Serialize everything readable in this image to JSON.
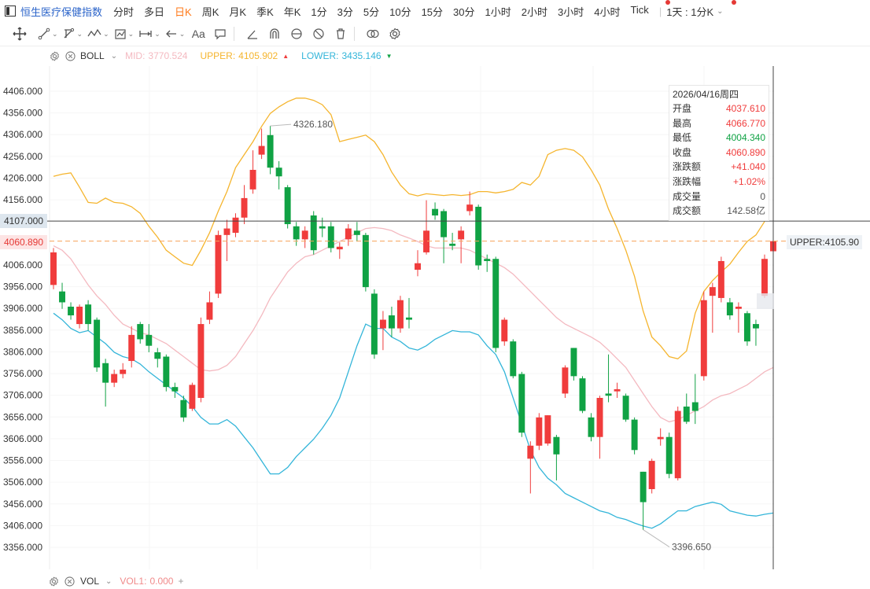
{
  "header": {
    "title": "恒生医疗保健指数",
    "timeframes": [
      "分时",
      "多日",
      "日K",
      "周K",
      "月K",
      "季K",
      "年K",
      "1分",
      "3分",
      "5分",
      "10分",
      "15分",
      "30分",
      "1小时",
      "2小时",
      "3小时",
      "4小时",
      "Tick"
    ],
    "active_timeframe": "日K",
    "period_select": "1天 : 1分K"
  },
  "toolbar": {
    "text_tool_label": "Aa"
  },
  "indicator": {
    "name": "BOLL",
    "mid_label": "MID:",
    "mid_value": "3770.524",
    "upper_label": "UPPER:",
    "upper_value": "4105.902",
    "lower_label": "LOWER:",
    "lower_value": "3435.146"
  },
  "volume": {
    "name": "VOL",
    "vol1_label": "VOL1:",
    "vol1_value": "0.000"
  },
  "colors": {
    "up": "#f03c3c",
    "down": "#10a244",
    "mid": "#f4b9c0",
    "upper": "#f5b52e",
    "lower": "#33b5d9",
    "accent": "#2a63c9"
  },
  "info": {
    "date": "2026/04/16周四",
    "rows": [
      {
        "k": "开盘",
        "v": "4037.610",
        "c": "up"
      },
      {
        "k": "最高",
        "v": "4066.770",
        "c": "up"
      },
      {
        "k": "最低",
        "v": "4004.340",
        "c": "down"
      },
      {
        "k": "收盘",
        "v": "4060.890",
        "c": "up"
      },
      {
        "k": "涨跌额",
        "v": "+41.040",
        "c": "up"
      },
      {
        "k": "涨跌幅",
        "v": "+1.02%",
        "c": "up"
      },
      {
        "k": "成交量",
        "v": "0",
        "c": "neutral"
      },
      {
        "k": "成交额",
        "v": "142.58亿",
        "c": "neutral"
      }
    ]
  },
  "tags": {
    "cross_price": "4107.000",
    "last_price": "4060.890",
    "upper_tag": "UPPER:4105.90"
  },
  "chart_data": {
    "type": "candlestick",
    "y_ticks": [
      "4406.000",
      "4356.000",
      "4306.000",
      "4256.000",
      "4206.000",
      "4156.000",
      "4107.000",
      "4060.890",
      "4006.000",
      "3956.000",
      "3906.000",
      "3856.000",
      "3806.000",
      "3756.000",
      "3706.000",
      "3656.000",
      "3606.000",
      "3556.000",
      "3506.000",
      "3456.000",
      "3406.000",
      "3356.000"
    ],
    "y_range": [
      3330,
      4440
    ],
    "max_label": "4326.180",
    "min_label": "3396.650",
    "candles": [
      {
        "o": 3960,
        "c": 4035,
        "h": 4045,
        "l": 3950
      },
      {
        "o": 3945,
        "c": 3920,
        "h": 3965,
        "l": 3905
      },
      {
        "o": 3910,
        "c": 3890,
        "h": 3920,
        "l": 3880
      },
      {
        "o": 3870,
        "c": 3910,
        "h": 3915,
        "l": 3860
      },
      {
        "o": 3915,
        "c": 3870,
        "h": 3925,
        "l": 3855
      },
      {
        "o": 3880,
        "c": 3770,
        "h": 3885,
        "l": 3760
      },
      {
        "o": 3780,
        "c": 3735,
        "h": 3790,
        "l": 3680
      },
      {
        "o": 3735,
        "c": 3755,
        "h": 3765,
        "l": 3725
      },
      {
        "o": 3755,
        "c": 3765,
        "h": 3780,
        "l": 3745
      },
      {
        "o": 3785,
        "c": 3845,
        "h": 3865,
        "l": 3770
      },
      {
        "o": 3870,
        "c": 3835,
        "h": 3875,
        "l": 3825
      },
      {
        "o": 3845,
        "c": 3820,
        "h": 3870,
        "l": 3805
      },
      {
        "o": 3805,
        "c": 3790,
        "h": 3815,
        "l": 3770
      },
      {
        "o": 3795,
        "c": 3725,
        "h": 3800,
        "l": 3715
      },
      {
        "o": 3725,
        "c": 3715,
        "h": 3735,
        "l": 3700
      },
      {
        "o": 3695,
        "c": 3655,
        "h": 3705,
        "l": 3645
      },
      {
        "o": 3675,
        "c": 3730,
        "h": 3735,
        "l": 3670
      },
      {
        "o": 3700,
        "c": 3870,
        "h": 3885,
        "l": 3690
      },
      {
        "o": 3880,
        "c": 3920,
        "h": 3945,
        "l": 3870
      },
      {
        "o": 3940,
        "c": 4075,
        "h": 4085,
        "l": 3930
      },
      {
        "o": 4075,
        "c": 4090,
        "h": 4110,
        "l": 4015
      },
      {
        "o": 4080,
        "c": 4115,
        "h": 4125,
        "l": 4070
      },
      {
        "o": 4115,
        "c": 4160,
        "h": 4190,
        "l": 4100
      },
      {
        "o": 4180,
        "c": 4225,
        "h": 4270,
        "l": 4170
      },
      {
        "o": 4260,
        "c": 4280,
        "h": 4320,
        "l": 4250
      },
      {
        "o": 4305,
        "c": 4230,
        "h": 4326,
        "l": 4215
      },
      {
        "o": 4230,
        "c": 4210,
        "h": 4245,
        "l": 4180
      },
      {
        "o": 4185,
        "c": 4100,
        "h": 4190,
        "l": 4090
      },
      {
        "o": 4095,
        "c": 4065,
        "h": 4105,
        "l": 4050
      },
      {
        "o": 4065,
        "c": 4085,
        "h": 4095,
        "l": 4045
      },
      {
        "o": 4120,
        "c": 4040,
        "h": 4130,
        "l": 4030
      },
      {
        "o": 4095,
        "c": 4090,
        "h": 4115,
        "l": 4070
      },
      {
        "o": 4095,
        "c": 4045,
        "h": 4105,
        "l": 4035
      },
      {
        "o": 4042,
        "c": 4048,
        "h": 4058,
        "l": 4020
      },
      {
        "o": 4065,
        "c": 4090,
        "h": 4100,
        "l": 4050
      },
      {
        "o": 4085,
        "c": 4075,
        "h": 4105,
        "l": 4060
      },
      {
        "o": 4075,
        "c": 3955,
        "h": 4080,
        "l": 3945
      },
      {
        "o": 3940,
        "c": 3800,
        "h": 3950,
        "l": 3790
      },
      {
        "o": 3860,
        "c": 3880,
        "h": 3900,
        "l": 3810
      },
      {
        "o": 3890,
        "c": 3860,
        "h": 3910,
        "l": 3840
      },
      {
        "o": 3860,
        "c": 3925,
        "h": 3935,
        "l": 3850
      },
      {
        "o": 3885,
        "c": 3880,
        "h": 3930,
        "l": 3860
      },
      {
        "o": 3995,
        "c": 4010,
        "h": 4040,
        "l": 3980
      },
      {
        "o": 4035,
        "c": 4085,
        "h": 4155,
        "l": 4030
      },
      {
        "o": 4135,
        "c": 4120,
        "h": 4150,
        "l": 4110
      },
      {
        "o": 4130,
        "c": 4070,
        "h": 4135,
        "l": 4010
      },
      {
        "o": 4055,
        "c": 4050,
        "h": 4080,
        "l": 4040
      },
      {
        "o": 4065,
        "c": 4085,
        "h": 4095,
        "l": 4010
      },
      {
        "o": 4130,
        "c": 4145,
        "h": 4175,
        "l": 4120
      },
      {
        "o": 4140,
        "c": 4005,
        "h": 4145,
        "l": 3995
      },
      {
        "o": 4020,
        "c": 4015,
        "h": 4030,
        "l": 3990
      },
      {
        "o": 4020,
        "c": 3815,
        "h": 4025,
        "l": 3805
      },
      {
        "o": 3830,
        "c": 3880,
        "h": 3885,
        "l": 3820
      },
      {
        "o": 3830,
        "c": 3750,
        "h": 3835,
        "l": 3745
      },
      {
        "o": 3755,
        "c": 3620,
        "h": 3760,
        "l": 3610
      },
      {
        "o": 3560,
        "c": 3590,
        "h": 3600,
        "l": 3480
      },
      {
        "o": 3590,
        "c": 3655,
        "h": 3665,
        "l": 3580
      },
      {
        "o": 3595,
        "c": 3660,
        "h": 3660,
        "l": 3590
      },
      {
        "o": 3610,
        "c": 3570,
        "h": 3615,
        "l": 3510
      },
      {
        "o": 3710,
        "c": 3770,
        "h": 3775,
        "l": 3700
      },
      {
        "o": 3815,
        "c": 3750,
        "h": 3815,
        "l": 3740
      },
      {
        "o": 3745,
        "c": 3670,
        "h": 3750,
        "l": 3665
      },
      {
        "o": 3655,
        "c": 3610,
        "h": 3665,
        "l": 3600
      },
      {
        "o": 3610,
        "c": 3700,
        "h": 3705,
        "l": 3560
      },
      {
        "o": 3710,
        "c": 3705,
        "h": 3800,
        "l": 3690
      },
      {
        "o": 3715,
        "c": 3720,
        "h": 3735,
        "l": 3700
      },
      {
        "o": 3705,
        "c": 3650,
        "h": 3710,
        "l": 3645
      },
      {
        "o": 3650,
        "c": 3580,
        "h": 3655,
        "l": 3570
      },
      {
        "o": 3530,
        "c": 3460,
        "h": 3530,
        "l": 3396
      },
      {
        "o": 3490,
        "c": 3555,
        "h": 3560,
        "l": 3480
      },
      {
        "o": 3605,
        "c": 3610,
        "h": 3630,
        "l": 3590
      },
      {
        "o": 3610,
        "c": 3525,
        "h": 3620,
        "l": 3515
      },
      {
        "o": 3515,
        "c": 3670,
        "h": 3680,
        "l": 3510
      },
      {
        "o": 3680,
        "c": 3645,
        "h": 3710,
        "l": 3640
      },
      {
        "o": 3690,
        "c": 3670,
        "h": 3755,
        "l": 3640
      },
      {
        "o": 3750,
        "c": 3925,
        "h": 3945,
        "l": 3740
      },
      {
        "o": 3935,
        "c": 3955,
        "h": 3965,
        "l": 3850
      },
      {
        "o": 3930,
        "c": 4015,
        "h": 4025,
        "l": 3920
      },
      {
        "o": 3920,
        "c": 3890,
        "h": 3930,
        "l": 3880
      },
      {
        "o": 3905,
        "c": 3910,
        "h": 3920,
        "l": 3850
      },
      {
        "o": 3895,
        "c": 3830,
        "h": 3900,
        "l": 3820
      },
      {
        "o": 3870,
        "c": 3860,
        "h": 3880,
        "l": 3820
      },
      {
        "o": 3935,
        "c": 4020,
        "h": 4030,
        "l": 3930
      },
      {
        "o": 4037.61,
        "c": 4060.89,
        "h": 4066.77,
        "l": 4004.34
      }
    ],
    "boll_mid": [
      4050,
      4040,
      4020,
      3990,
      3960,
      3935,
      3915,
      3890,
      3870,
      3860,
      3850,
      3845,
      3835,
      3825,
      3810,
      3795,
      3780,
      3765,
      3762,
      3765,
      3775,
      3795,
      3825,
      3855,
      3890,
      3930,
      3960,
      3990,
      4010,
      4025,
      4030,
      4040,
      4050,
      4060,
      4070,
      4080,
      4090,
      4092,
      4090,
      4085,
      4075,
      4068,
      4060,
      4050,
      4045,
      4045,
      4045,
      4045,
      4040,
      4030,
      4020,
      4010,
      4000,
      3985,
      3965,
      3945,
      3925,
      3905,
      3885,
      3870,
      3860,
      3850,
      3840,
      3828,
      3810,
      3790,
      3770,
      3740,
      3710,
      3680,
      3655,
      3645,
      3650,
      3660,
      3670,
      3680,
      3695,
      3705,
      3710,
      3720,
      3730,
      3745,
      3760,
      3770
    ],
    "boll_upper": [
      4210,
      4215,
      4218,
      4185,
      4150,
      4148,
      4160,
      4150,
      4148,
      4140,
      4125,
      4095,
      4070,
      4040,
      4025,
      4010,
      4005,
      4040,
      4080,
      4130,
      4175,
      4230,
      4260,
      4290,
      4325,
      4355,
      4370,
      4382,
      4390,
      4390,
      4385,
      4375,
      4352,
      4290,
      4295,
      4300,
      4305,
      4290,
      4260,
      4220,
      4190,
      4170,
      4165,
      4170,
      4168,
      4166,
      4168,
      4166,
      4168,
      4175,
      4175,
      4172,
      4175,
      4180,
      4196,
      4190,
      4210,
      4260,
      4270,
      4274,
      4270,
      4255,
      4225,
      4190,
      4135,
      4090,
      4040,
      3980,
      3900,
      3840,
      3820,
      3795,
      3790,
      3808,
      3895,
      3945,
      3970,
      3990,
      4008,
      4035,
      4060,
      4075,
      4106
    ],
    "boll_lower": [
      3895,
      3880,
      3860,
      3850,
      3855,
      3840,
      3825,
      3805,
      3795,
      3790,
      3778,
      3760,
      3745,
      3730,
      3715,
      3700,
      3680,
      3655,
      3640,
      3640,
      3650,
      3635,
      3610,
      3585,
      3555,
      3525,
      3525,
      3540,
      3565,
      3585,
      3605,
      3630,
      3660,
      3700,
      3760,
      3820,
      3870,
      3860,
      3860,
      3840,
      3830,
      3815,
      3810,
      3820,
      3835,
      3845,
      3855,
      3852,
      3852,
      3845,
      3820,
      3800,
      3760,
      3700,
      3640,
      3580,
      3540,
      3515,
      3500,
      3480,
      3470,
      3460,
      3450,
      3440,
      3435,
      3425,
      3420,
      3412,
      3405,
      3400,
      3410,
      3425,
      3440,
      3440,
      3450,
      3455,
      3460,
      3455,
      3440,
      3435,
      3430,
      3428,
      3432,
      3435
    ]
  }
}
